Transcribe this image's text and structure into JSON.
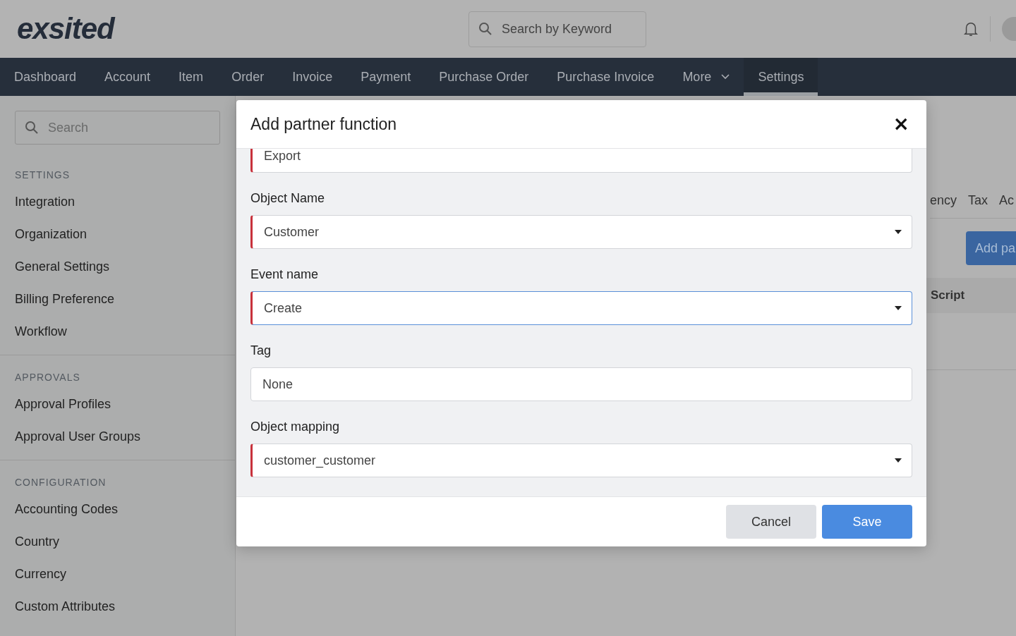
{
  "header": {
    "logo": "exsited",
    "search": {
      "placeholder": "Search by Keyword"
    }
  },
  "nav": [
    {
      "label": "Dashboard",
      "selected": false,
      "kind": "link"
    },
    {
      "label": "Account",
      "selected": false,
      "kind": "link"
    },
    {
      "label": "Item",
      "selected": false,
      "kind": "link"
    },
    {
      "label": "Order",
      "selected": false,
      "kind": "link"
    },
    {
      "label": "Invoice",
      "selected": false,
      "kind": "link"
    },
    {
      "label": "Payment",
      "selected": false,
      "kind": "link"
    },
    {
      "label": "Purchase Order",
      "selected": false,
      "kind": "link"
    },
    {
      "label": "Purchase Invoice",
      "selected": false,
      "kind": "link"
    },
    {
      "label": "More",
      "selected": false,
      "kind": "menu"
    },
    {
      "label": "Settings",
      "selected": true,
      "kind": "link"
    }
  ],
  "sidebar": {
    "search": {
      "placeholder": "Search"
    },
    "sections": [
      {
        "title": "SETTINGS",
        "items": [
          "Integration",
          "Organization",
          "General Settings",
          "Billing Preference",
          "Workflow"
        ]
      },
      {
        "title": "APPROVALS",
        "items": [
          "Approval Profiles",
          "Approval User Groups"
        ]
      },
      {
        "title": "CONFIGURATION",
        "items": [
          "Accounting Codes",
          "Country",
          "Currency",
          "Custom Attributes"
        ]
      }
    ]
  },
  "content": {
    "tabs": [
      "ency",
      "Tax",
      "Ac"
    ],
    "add_button": "Add pa",
    "table": {
      "columns": [
        "Script"
      ]
    }
  },
  "modal": {
    "title": "Add partner function",
    "close": "×",
    "fields": [
      {
        "value": "Export",
        "kind": "text",
        "required": true,
        "focused": false
      },
      {
        "label": "Object Name",
        "value": "Customer",
        "kind": "select",
        "required": true,
        "focused": false
      },
      {
        "label": "Event name",
        "value": "Create",
        "kind": "select",
        "required": true,
        "focused": true
      },
      {
        "label": "Tag",
        "value": "None",
        "kind": "text",
        "required": false,
        "focused": false
      },
      {
        "label": "Object mapping",
        "value": "customer_customer",
        "kind": "select",
        "required": true,
        "focused": false
      }
    ],
    "buttons": [
      {
        "label": "Cancel",
        "kind": "secondary"
      },
      {
        "label": "Save",
        "kind": "primary"
      }
    ]
  }
}
